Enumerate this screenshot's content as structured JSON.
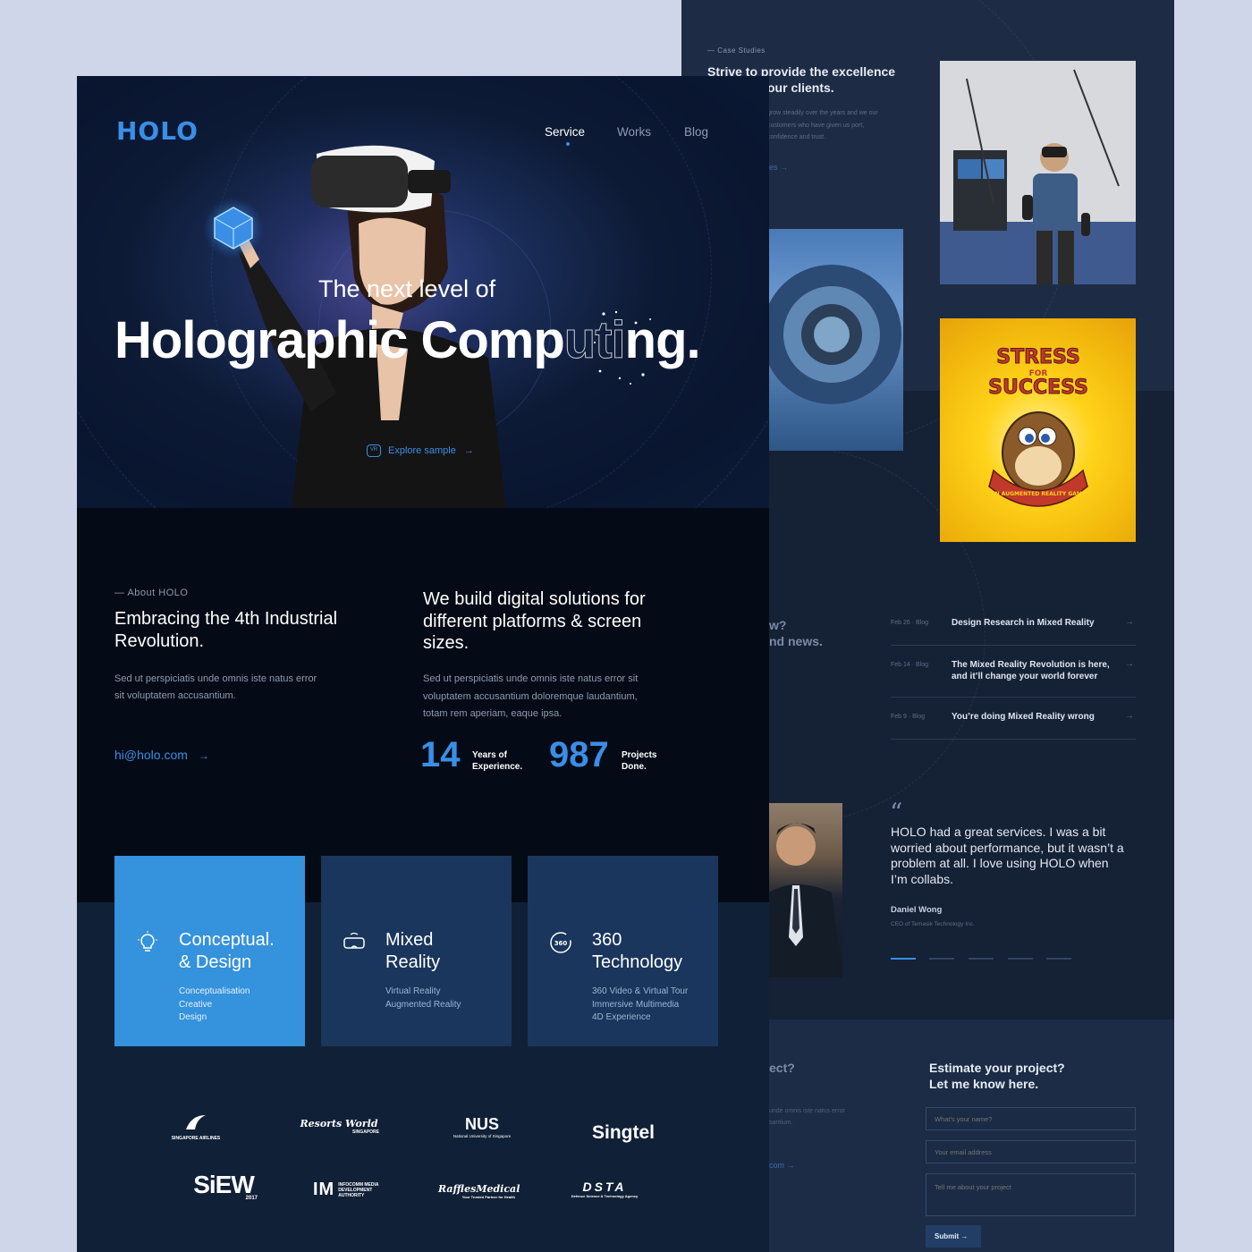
{
  "header": {
    "logo": "HOLO",
    "nav": [
      {
        "label": "Service",
        "active": true
      },
      {
        "label": "Works",
        "active": false
      },
      {
        "label": "Blog",
        "active": false
      }
    ]
  },
  "hero": {
    "subtitle": "The next level of",
    "title_a": "Holographic Comp",
    "title_ghost": "uti",
    "title_b": "ng.",
    "cta": "Explore sample",
    "cta_icon": "VR",
    "cta_arrow": "→"
  },
  "about": {
    "label": "— About HOLO",
    "title": "Embracing the 4th Industrial Revolution.",
    "desc": "Sed ut perspiciatis unde omnis iste natus error sit voluptatem accusantium.",
    "email": "hi@holo.com",
    "email_arrow": "→"
  },
  "build": {
    "title": "We build digital solutions for different platforms & screen sizes.",
    "desc": "Sed ut perspiciatis unde omnis iste natus error sit voluptatem accusantium doloremque laudantium, totam rem aperiam, eaque ipsa.",
    "stats": [
      {
        "value": "14",
        "label_1": "Years of",
        "label_2": "Experience."
      },
      {
        "value": "987",
        "label_1": "Projects",
        "label_2": "Done."
      }
    ]
  },
  "services": [
    {
      "icon": "lightbulb-icon",
      "title_1": "Conceptual.",
      "title_2": "& Design",
      "lines": [
        "Conceptualisation",
        "Creative",
        "Design"
      ],
      "active": true
    },
    {
      "icon": "vr-headset-icon",
      "title_1": "Mixed",
      "title_2": "Reality",
      "lines": [
        "Virtual Reality",
        "Augmented Reality"
      ],
      "active": false
    },
    {
      "icon": "360-icon",
      "title_1": "360",
      "title_2": "Technology",
      "lines": [
        "360 Video & Virtual Tour",
        "Immersive Multimedia",
        "4D Experience"
      ],
      "active": false
    }
  ],
  "partners": [
    {
      "name": "SINGAPORE AIRLINES"
    },
    {
      "name": "Resorts World",
      "sub": "SINGAPORE"
    },
    {
      "name": "NUS",
      "sub": "National University of Singapore"
    },
    {
      "name": "Singtel"
    },
    {
      "name": "SiEW",
      "sub": "2017"
    },
    {
      "name": "IM",
      "sub": "INFOCOMM MEDIA DEVELOPMENT AUTHORITY"
    },
    {
      "name": "RafflesMedical",
      "sub": "Your Trusted Partner for Health"
    },
    {
      "name": "DSTA",
      "sub": "Defence Science & Technology Agency"
    }
  ],
  "case_studies": {
    "label": "— Case Studies",
    "title_1": "Strive to provide the excellence",
    "title_2": "our clients.",
    "desc": "grow steadily over the years and we our customers who have given us port, confidence and trust.",
    "link": "ies →"
  },
  "game": {
    "top": "STRESS",
    "mid": "FOR",
    "bottom": "SUCCESS",
    "ribbon": "AN AUGMENTED REALITY GAME"
  },
  "news": {
    "side_1": "w?",
    "side_2": "nd news.",
    "items": [
      {
        "date": "Feb 26 · Blog",
        "title": "Design Research in Mixed Reality"
      },
      {
        "date": "Feb 14 · Blog",
        "title": "The Mixed Reality Revolution is here, and it’ll change your world forever"
      },
      {
        "date": "Feb 9 · Blog",
        "title": "You’re doing Mixed Reality wrong"
      }
    ],
    "arrow": "→"
  },
  "testimonial": {
    "quote_mark": "“",
    "text": "HOLO had a great services. I was a bit worried about performance, but it wasn’t a problem at all. I love using HOLO when I’m collabs.",
    "name": "Daniel Wong",
    "role": "CEO of Temasik Technology Inc."
  },
  "estimate": {
    "side_1": "ect?",
    "side_2": "unde omnis iste natus error santium.",
    "side_link": "com →",
    "title_1": "Estimate your project?",
    "title_2": "Let me know here.",
    "name_placeholder": "What's your name?",
    "email_placeholder": "Your email address",
    "project_placeholder": "Tell me about your project",
    "submit": "Submit  →"
  },
  "colors": {
    "accent": "#3a8ee6",
    "card_active": "#3592dc",
    "card": "#1a365c",
    "game_yellow": "#ffd31a"
  }
}
